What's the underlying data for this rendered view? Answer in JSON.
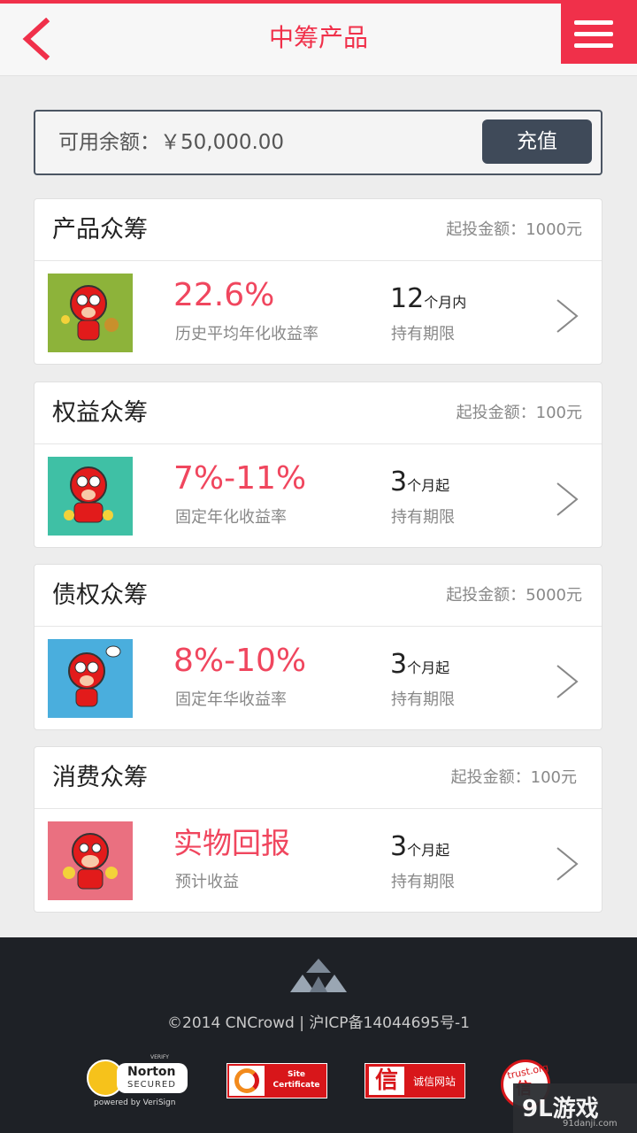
{
  "header": {
    "title": "中筹产品",
    "back_icon": "chevron-left-icon",
    "menu_icon": "hamburger-icon"
  },
  "balance": {
    "label": "可用余额：￥50,000.00",
    "button": "充值"
  },
  "cards": [
    {
      "name": "产品众筹",
      "min_label": "起投金额：",
      "min_value": "1000元",
      "rate": "22.6%",
      "rate_label": "历史平均年化收益率",
      "term_num": "12",
      "term_unit": "个月内",
      "term_label": "持有期限",
      "thumb_color": "#8db33a"
    },
    {
      "name": "权益众筹",
      "min_label": "起投金额：",
      "min_value": "100元",
      "rate": "7%-11%",
      "rate_label": "固定年化收益率",
      "term_num": "3",
      "term_unit": "个月起",
      "term_label": "持有期限",
      "thumb_color": "#3fc0a5"
    },
    {
      "name": "债权众筹",
      "min_label": "起投金额：",
      "min_value": "5000元",
      "rate": "8%-10%",
      "rate_label": "固定年华收益率",
      "term_num": "3",
      "term_unit": "个月起",
      "term_label": "持有期限",
      "thumb_color": "#4aaedd"
    },
    {
      "name": "消费众筹",
      "min_label": "起投金额：",
      "min_value": "100元",
      "rate": "实物回报",
      "rate_label": "预计收益",
      "term_num": "3",
      "term_unit": "个月起",
      "term_label": "持有期限",
      "thumb_color": "#ea7080"
    }
  ],
  "footer": {
    "copyright": "©2014 CNCrowd  |  沪ICP备14044695号-1",
    "badges": {
      "norton_verify": "VERIFY",
      "norton_name": "Norton",
      "norton_secured": "SECURED",
      "norton_powered": "powered by VeriSign",
      "site_cert": "Site Certificate",
      "chengxin_icon": "信",
      "chengxin": "诚信网站",
      "trust_arc": "trust.org",
      "trust_big": "信"
    }
  },
  "watermark": {
    "text": "9L游戏",
    "sub": "91danji.com"
  },
  "colors": {
    "accent": "#f0304a",
    "dark": "#3f4a59",
    "footer": "#1e2126"
  }
}
